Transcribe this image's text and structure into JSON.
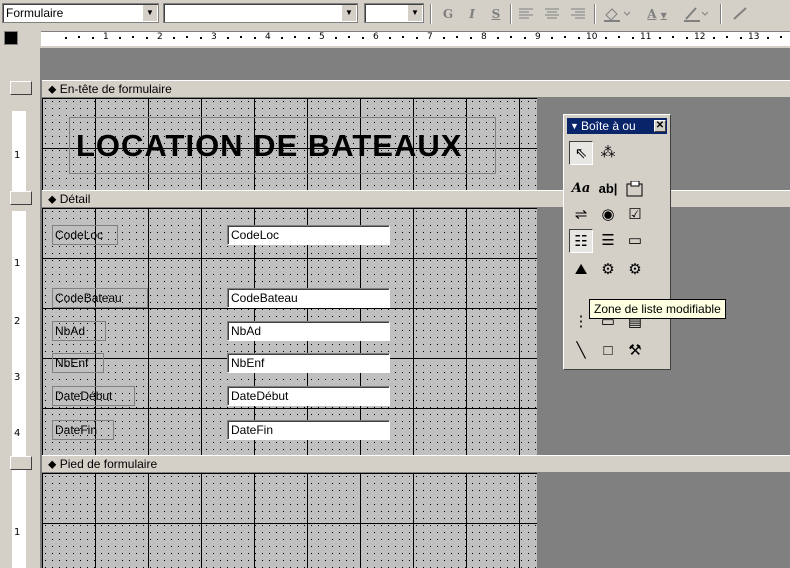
{
  "toolbar": {
    "object_combo": "Formulaire",
    "font_combo": "",
    "size_combo": "",
    "bold": "G",
    "italic": "I",
    "underline": "S",
    "align_left_icon": "align-left-icon",
    "align_center_icon": "align-center-icon",
    "align_right_icon": "align-right-icon",
    "fill_color_icon": "fill-color-icon",
    "font_color_label": "A",
    "line_color_icon": "line-color-icon"
  },
  "ruler": {
    "numbers": [
      "1",
      "2",
      "3",
      "4",
      "5",
      "6",
      "7",
      "8",
      "9",
      "10",
      "11",
      "12",
      "13"
    ]
  },
  "vruler": {
    "header_marks": [
      "1"
    ],
    "detail_marks": [
      "1",
      "2",
      "3",
      "4"
    ],
    "footer_marks": [
      "1"
    ]
  },
  "sections": {
    "header": "En-tête de formulaire",
    "detail": "Détail",
    "footer": "Pied de formulaire"
  },
  "form_title": "LOCATION DE BATEAUX",
  "fields": [
    {
      "label": "CodeLoc",
      "value": "CodeLoc"
    },
    {
      "label": "CodeBateau",
      "value": "CodeBateau"
    },
    {
      "label": "NbAd",
      "value": "NbAd"
    },
    {
      "label": "NbEnf",
      "value": "NbEnf"
    },
    {
      "label": "DateDébut",
      "value": "DateDébut"
    },
    {
      "label": "DateFin",
      "value": "DateFin"
    }
  ],
  "toolbox": {
    "title": "Boîte à ou",
    "tooltip": "Zone de liste modifiable",
    "tools": [
      "select-objects-icon",
      "wizard-icon",
      "label-icon",
      "textbox-icon",
      "option-group-icon",
      "toggle-button-icon",
      "option-button-icon",
      "checkbox-icon",
      "combo-box-icon",
      "list-box-icon",
      "command-button-icon",
      "image-icon",
      "unbound-object-icon",
      "bound-object-icon",
      "page-break-icon",
      "tab-control-icon",
      "subform-icon",
      "line-icon",
      "rectangle-icon",
      "more-controls-icon"
    ],
    "label_text": "Aa",
    "textbox_text": "ab|"
  },
  "colors": {
    "canvas": "#c0c0c0",
    "chrome": "#d4d0c8",
    "titlebar": "#0a246a",
    "tooltip_bg": "#ffffe1"
  }
}
